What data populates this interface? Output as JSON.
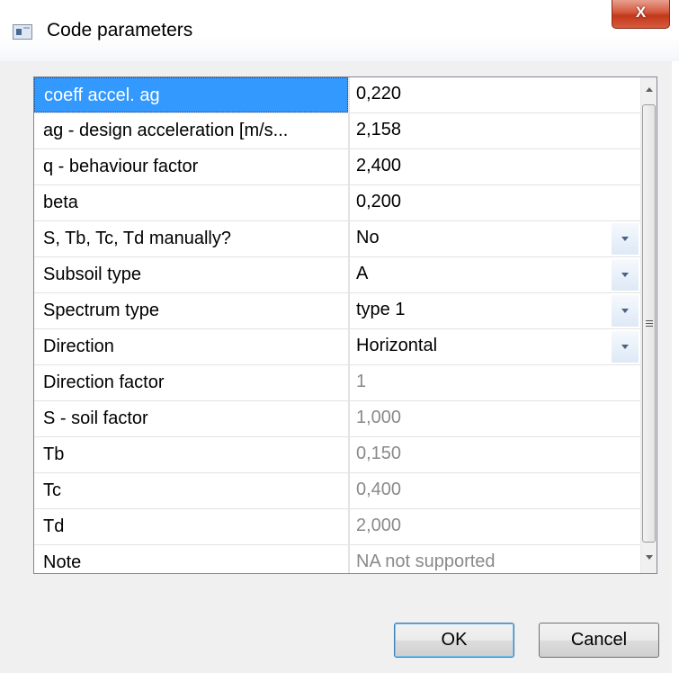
{
  "window": {
    "title": "Code parameters",
    "close_label": "X"
  },
  "grid": {
    "rows": [
      {
        "name": "coeff accel. ag",
        "value": "0,220",
        "dropdown": false,
        "readonly": false
      },
      {
        "name": "ag - design acceleration [m/s...",
        "value": "2,158",
        "dropdown": false,
        "readonly": false
      },
      {
        "name": "q - behaviour factor",
        "value": "2,400",
        "dropdown": false,
        "readonly": false
      },
      {
        "name": "beta",
        "value": "0,200",
        "dropdown": false,
        "readonly": false
      },
      {
        "name": "S, Tb, Tc, Td manually?",
        "value": "No",
        "dropdown": true,
        "readonly": false
      },
      {
        "name": "Subsoil type",
        "value": "A",
        "dropdown": true,
        "readonly": false
      },
      {
        "name": "Spectrum type",
        "value": "type 1",
        "dropdown": true,
        "readonly": false
      },
      {
        "name": "Direction",
        "value": "Horizontal",
        "dropdown": true,
        "readonly": false
      },
      {
        "name": "Direction factor",
        "value": "1",
        "dropdown": false,
        "readonly": true
      },
      {
        "name": "S - soil factor",
        "value": "1,000",
        "dropdown": false,
        "readonly": true
      },
      {
        "name": "Tb",
        "value": "0,150",
        "dropdown": false,
        "readonly": true
      },
      {
        "name": "Tc",
        "value": "0,400",
        "dropdown": false,
        "readonly": true
      },
      {
        "name": "Td",
        "value": "2,000",
        "dropdown": false,
        "readonly": true
      },
      {
        "name": "Note",
        "value": "NA not supported",
        "dropdown": false,
        "readonly": true
      }
    ]
  },
  "buttons": {
    "ok": "OK",
    "cancel": "Cancel"
  },
  "colors": {
    "selection": "#3399ff",
    "readonly_text": "#8a8a8a",
    "close_button": "#c2381b"
  }
}
